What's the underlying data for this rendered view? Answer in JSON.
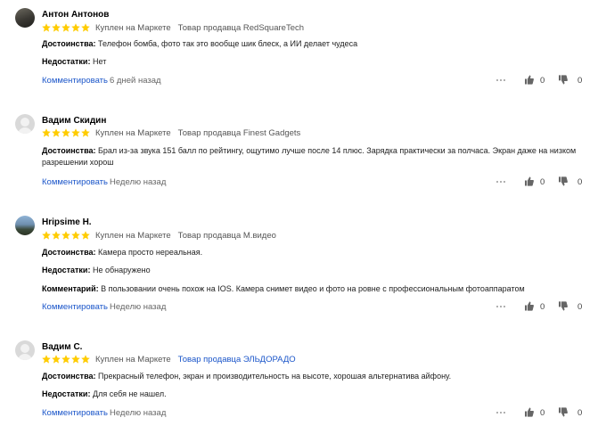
{
  "labels": {
    "pros": "Достоинства:",
    "cons": "Недостатки:",
    "comment": "Комментарий:",
    "comment_link": "Комментировать"
  },
  "reviews": [
    {
      "author": "Антон Антонов",
      "rating": 5,
      "purchase": "Куплен на Маркете",
      "seller": "Товар продавца RedSquareTech",
      "pros": "Телефон бомба, фото так это вообще шик блеск, а ИИ делает чудеса",
      "cons": "Нет",
      "age": "6 дней назад",
      "likes": "0",
      "dislikes": "0"
    },
    {
      "author": "Вадим Скидин",
      "rating": 5,
      "purchase": "Куплен на Маркете",
      "seller": "Товар продавца Finest Gadgets",
      "pros_line1": "Брал из-за звука 151 балл по рейтингу, ощутимо лучше после 14 плюс. Зарядка практически за полчаса. Экран даже на низком",
      "pros_line2": "разрешении хорош",
      "age": "Неделю назад",
      "likes": "0",
      "dislikes": "0"
    },
    {
      "author": "Hripsime H.",
      "rating": 5,
      "purchase": "Куплен на Маркете",
      "seller": "Товар продавца М.видео",
      "pros": "Камера просто нереальная.",
      "cons": "Не обнаружено",
      "comment": "В пользовании очень похож на IOS. Камера снимет видео и фото на ровне с профессиональным фотоаппаратом",
      "age": "Неделю назад",
      "likes": "0",
      "dislikes": "0"
    },
    {
      "author": "Вадим С.",
      "rating": 5,
      "purchase": "Куплен на Маркете",
      "seller": "Товар продавца ЭЛЬДОРАДО",
      "pros": "Прекрасный телефон, экран и производительность на высоте, хорошая альтернатива айфону.",
      "cons": "Для себя не нашел.",
      "age": "Неделю назад",
      "likes": "0",
      "dislikes": "0"
    }
  ],
  "colors": {
    "star": "#fc0",
    "link": "#1a55c9"
  },
  "icons": {
    "rating": "star-icon",
    "more": "more-dots-icon",
    "like": "thumb-up-icon",
    "dislike": "thumb-down-icon"
  }
}
